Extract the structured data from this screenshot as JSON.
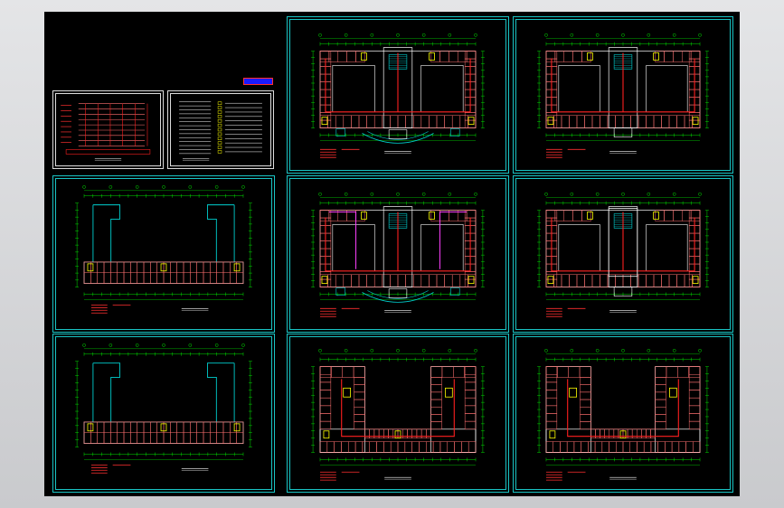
{
  "viewport": {
    "background": "#d4d5d7",
    "canvas_background": "#000000"
  },
  "colors": {
    "frame": "#19c4c4",
    "wall": "#ffffff",
    "room": "#ff7070",
    "wiring": "#ff2020",
    "grid": "#00e000",
    "axis": "#ffff00",
    "stair": "#00d0d0",
    "note": "#ff3030",
    "magenta": "#ff40ff"
  },
  "sheets": [
    {
      "name": "sheet-riser-diagram",
      "kind": "riser"
    },
    {
      "name": "sheet-design-notes",
      "kind": "notes"
    },
    {
      "name": "sheet-first-floor-plan",
      "kind": "courtyard",
      "variant": "entrance"
    },
    {
      "name": "sheet-second-floor-plan",
      "kind": "courtyard",
      "variant": "wired"
    },
    {
      "name": "sheet-ground-floor-outline",
      "kind": "outline"
    },
    {
      "name": "sheet-basement-floor-plan",
      "kind": "courtyard",
      "variant": "magenta"
    },
    {
      "name": "sheet-third-floor-plan",
      "kind": "courtyard",
      "variant": "wired-atrium"
    },
    {
      "name": "sheet-roof-outline",
      "kind": "outline"
    },
    {
      "name": "sheet-fourth-floor-plan",
      "kind": "u-shape"
    },
    {
      "name": "sheet-fifth-floor-plan",
      "kind": "u-shape"
    }
  ]
}
